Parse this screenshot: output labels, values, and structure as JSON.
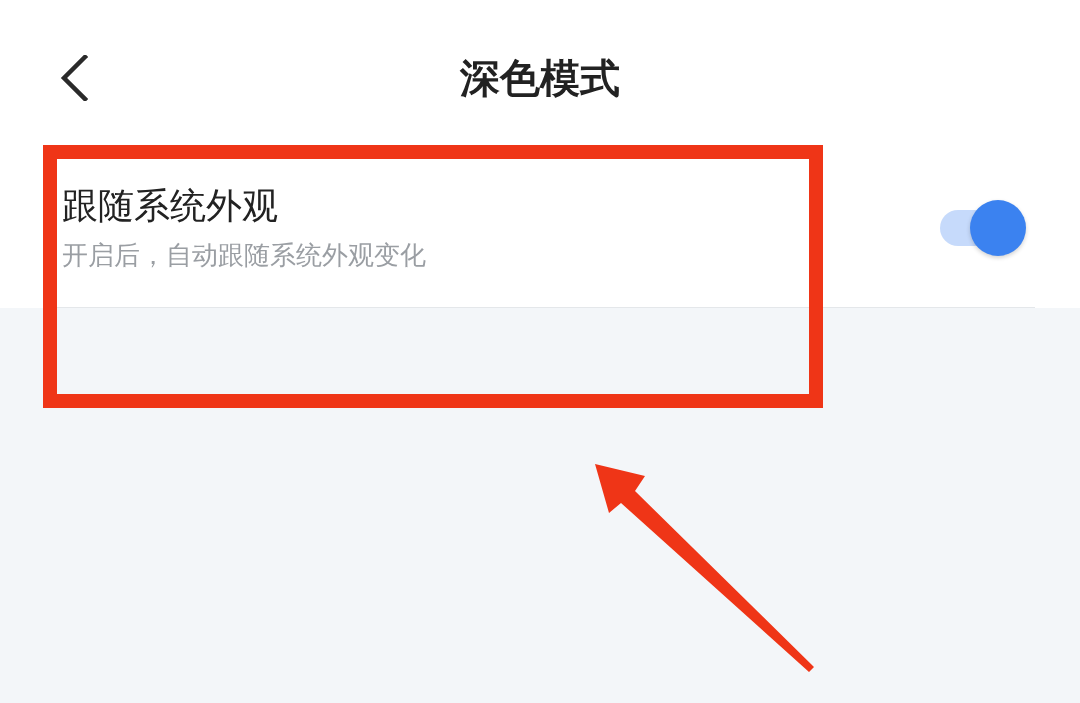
{
  "header": {
    "title": "深色模式"
  },
  "settings": [
    {
      "kind": "toggle",
      "label": "跟随系统外观",
      "description": "开启后，自动跟随系统外观变化",
      "on": true
    }
  ]
}
